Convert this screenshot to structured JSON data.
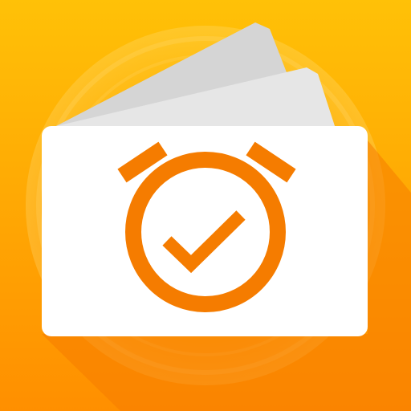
{
  "app_icon": {
    "icon_name": "alarm-clock-check-cards-icon",
    "colors": {
      "background_top": "#FFC107",
      "background_bottom": "#FF8F00",
      "glow_ring": "#FFE082",
      "long_shadow": "#F57C00",
      "card_front": "#FFFFFF",
      "card_back_1": "#E6E6E6",
      "card_back_2": "#D5D5D5",
      "clock_stroke": "#F57C00"
    }
  }
}
